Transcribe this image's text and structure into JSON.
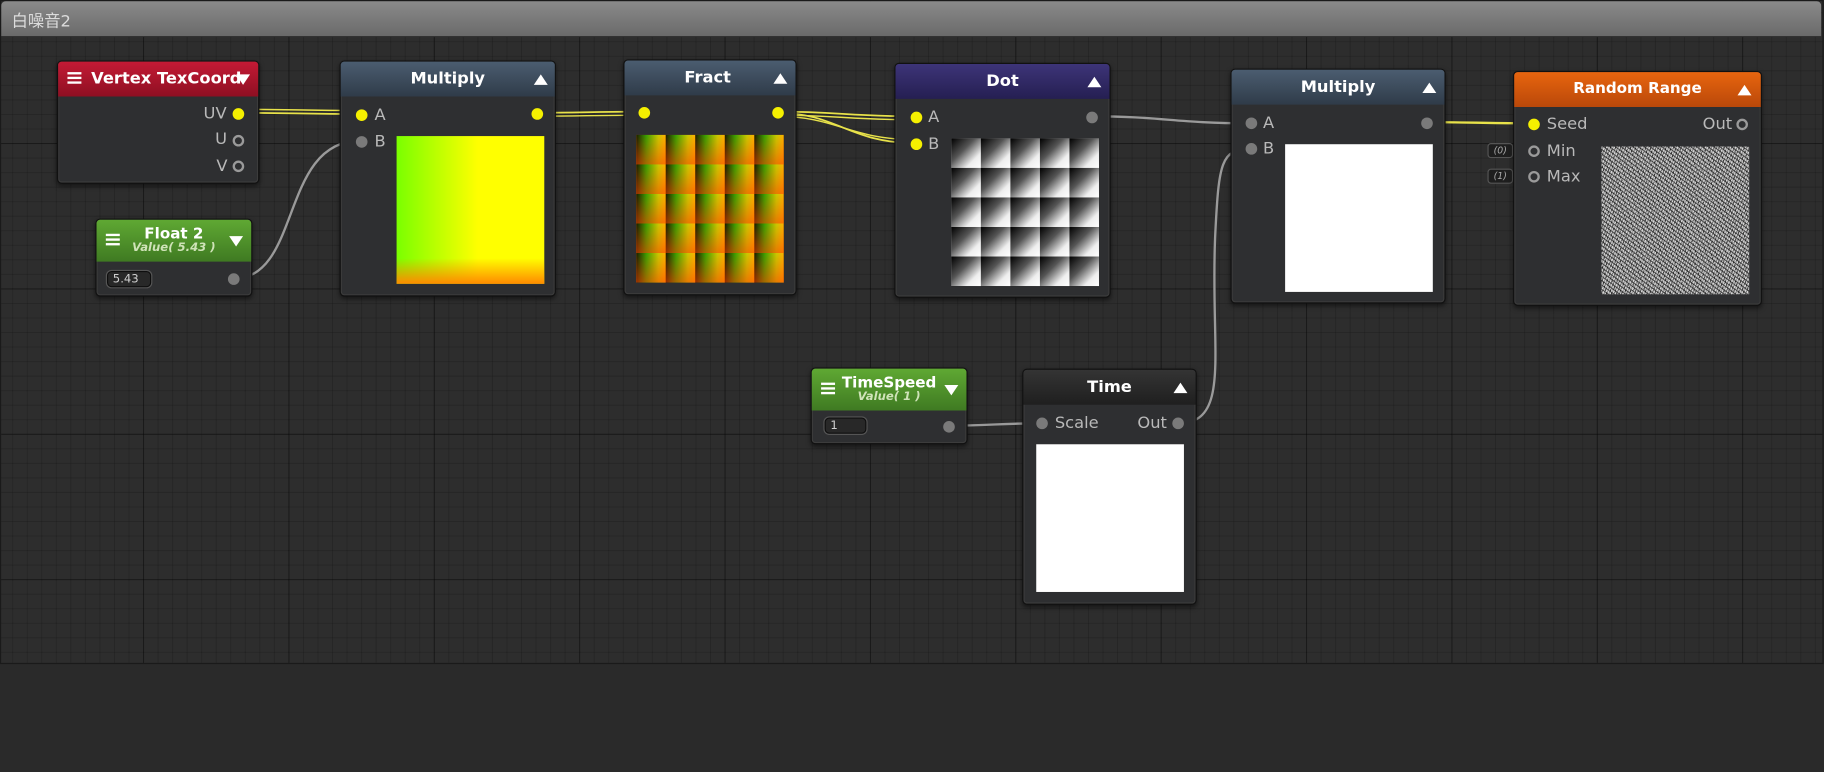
{
  "window": {
    "title": "白噪音2"
  },
  "nodes": {
    "vertex_texcoord": {
      "title": "Vertex TexCoord",
      "outputs": [
        "UV",
        "U",
        "V"
      ],
      "color": "#a8132a"
    },
    "float2": {
      "title": "Float 2",
      "subtitle": "Value( 5.43 )",
      "value": "5.43",
      "color": "#4f8f2b"
    },
    "multiply1": {
      "title": "Multiply",
      "inputs": [
        "A",
        "B"
      ],
      "color": "#3c4b5c"
    },
    "fract": {
      "title": "Fract",
      "color": "#3c4b5c"
    },
    "dot": {
      "title": "Dot",
      "inputs": [
        "A",
        "B"
      ],
      "color": "#352c6a"
    },
    "multiply2": {
      "title": "Multiply",
      "inputs": [
        "A",
        "B"
      ],
      "color": "#3c4b5c"
    },
    "random_range": {
      "title": "Random Range",
      "inputs": [
        "Seed",
        "Min",
        "Max"
      ],
      "output": "Out",
      "min_default": "(0)",
      "max_default": "(1)",
      "color": "#d65a0c"
    },
    "timespeed": {
      "title": "TimeSpeed",
      "subtitle": "Value( 1 )",
      "value": "1",
      "color": "#4f8f2b"
    },
    "time": {
      "title": "Time",
      "input": "Scale",
      "output": "Out",
      "color": "#2b2b2b"
    }
  },
  "colors": {
    "connected_port": "#f5f000",
    "wire_active": "#e8e24a",
    "wire_idle": "#9a9a9a",
    "background": "#2d2d2d"
  }
}
